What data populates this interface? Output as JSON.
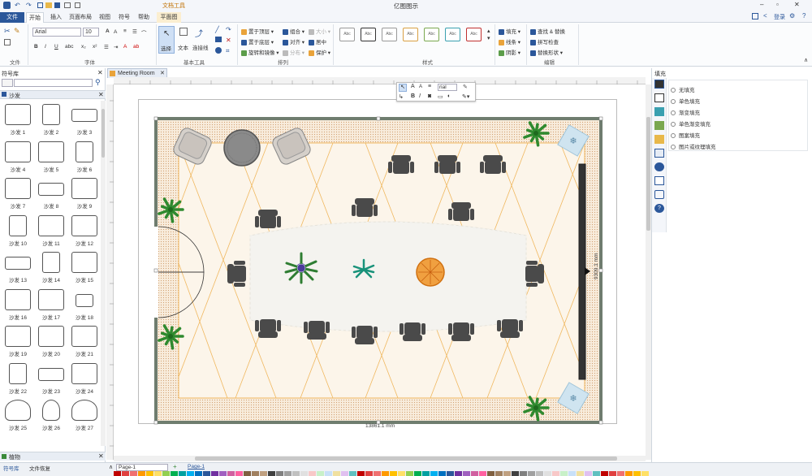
{
  "window": {
    "title": "亿图图示",
    "context_tab": "文档工具",
    "login": "登录"
  },
  "tabs": [
    "文件",
    "开始",
    "插入",
    "页面布局",
    "视图",
    "符号",
    "帮助",
    "平面图"
  ],
  "ribbon": {
    "groups": {
      "file": "文件",
      "font": "字体",
      "tools": "基本工具",
      "arrange": "排列",
      "style": "样式",
      "edit": "编辑"
    },
    "font_name": "Arial",
    "font_size": "10",
    "tools": {
      "select": "选择",
      "text": "文本",
      "connector": "连接线"
    },
    "arrange": {
      "bring_front": "置于顶层",
      "send_back": "置于底层",
      "rotate": "旋转和镜像",
      "group": "组合",
      "align": "对齐",
      "distribute": "分布",
      "size": "大小",
      "center": "居中",
      "protect": "保护"
    },
    "style_label": "Abc",
    "fill_btns": {
      "fill": "填充",
      "line": "线条",
      "shadow": "阴影"
    },
    "edit": {
      "find": "查找 & 替换",
      "spell": "拼写检查",
      "replace_shape": "替换形状"
    }
  },
  "left_panel": {
    "title": "符号库",
    "category": "沙发",
    "bottom_category": "植物",
    "symbols": [
      "沙发 1",
      "沙发 2",
      "沙发 3",
      "沙发 4",
      "沙发 5",
      "沙发 6",
      "沙发 7",
      "沙发 8",
      "沙发 9",
      "沙发 10",
      "沙发 11",
      "沙发 12",
      "沙发 13",
      "沙发 14",
      "沙发 15",
      "沙发 16",
      "沙发 17",
      "沙发 18",
      "沙发 19",
      "沙发 20",
      "沙发 21",
      "沙发 22",
      "沙发 23",
      "沙发 24",
      "沙发 25",
      "沙发 26",
      "沙发 27"
    ],
    "bottom_tabs": [
      "符号库",
      "文件恢复"
    ]
  },
  "document_tab": "Meeting Room",
  "mini_toolbar": {
    "font": "rial"
  },
  "dimensions": {
    "width": "13861.1 mm",
    "height": "9309.1 mm"
  },
  "right_panel": {
    "title": "填充",
    "options": [
      "无填充",
      "单色填充",
      "渐变填充",
      "单色渐变填充",
      "图案填充",
      "图片或纹理填充"
    ]
  },
  "status": {
    "page_select": "Page-1",
    "page_tab": "Page-1"
  },
  "colors": {
    "accent": "#2b579a",
    "carpet": "#f7e3c8",
    "grid": "#f0b860",
    "wall": "#5e6e5e",
    "chair": "#4a4a4a",
    "table": "#f3f2ee"
  }
}
